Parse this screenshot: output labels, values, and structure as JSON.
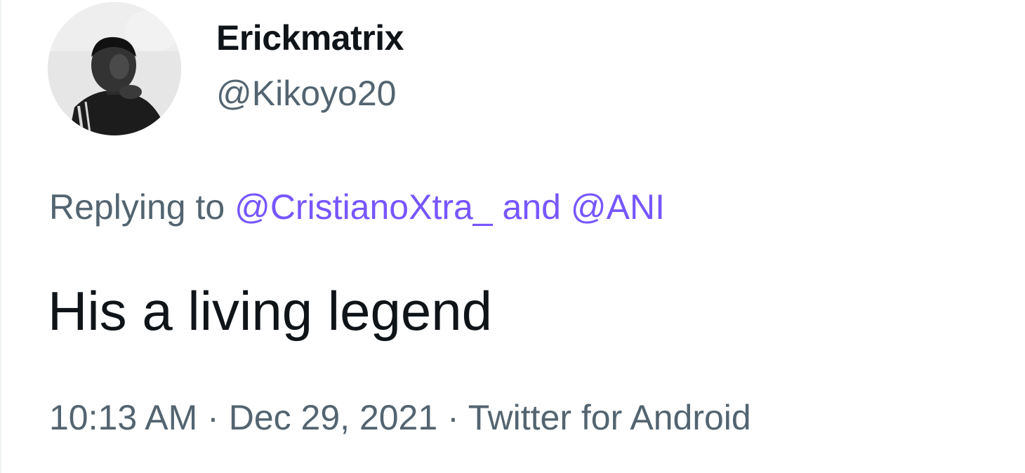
{
  "author": {
    "display_name": "Erickmatrix",
    "handle": "@Kikoyo20",
    "avatar_icon": "user-avatar-photo"
  },
  "reply": {
    "prefix": "Replying to",
    "mentions": [
      "@CristianoXtra_",
      "@ANI"
    ],
    "conjunction": "and"
  },
  "tweet": {
    "text": "His a living legend"
  },
  "meta": {
    "time": "10:13 AM",
    "separator": "·",
    "date": "Dec 29, 2021",
    "source": "Twitter for Android"
  },
  "colors": {
    "primary_text": "#0f1419",
    "secondary_text": "#536471",
    "mention": "#7856ff"
  }
}
